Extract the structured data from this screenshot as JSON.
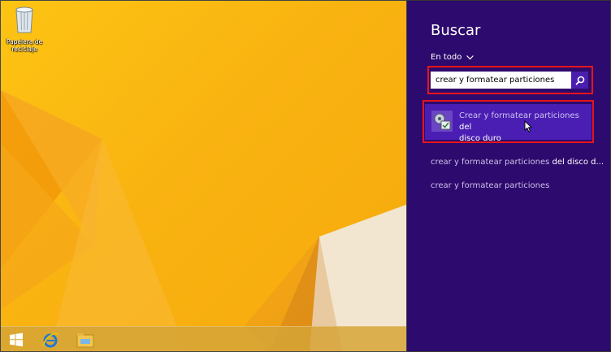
{
  "desktop": {
    "recycle_bin_label": "Papelera de reciclaje"
  },
  "taskbar": {
    "icons": [
      "windows-start-icon",
      "internet-explorer-icon",
      "file-explorer-icon"
    ]
  },
  "search_charm": {
    "title": "Buscar",
    "scope": "En todo",
    "query": "crear y formatear particiones",
    "top_result": {
      "match": "Crear y formatear particiones",
      "rest_line1": " del",
      "rest_line2": "disco duro"
    },
    "suggestions": [
      {
        "match": "crear y formatear particiones",
        "rest": " del disco d..."
      },
      {
        "match": "crear y formatear particiones",
        "rest": ""
      }
    ]
  },
  "colors": {
    "charm_bg": "#2d0a6d",
    "selection": "#4a1eb2",
    "highlight_frame": "#e8141c",
    "desktop_bg": "#f9b311"
  }
}
